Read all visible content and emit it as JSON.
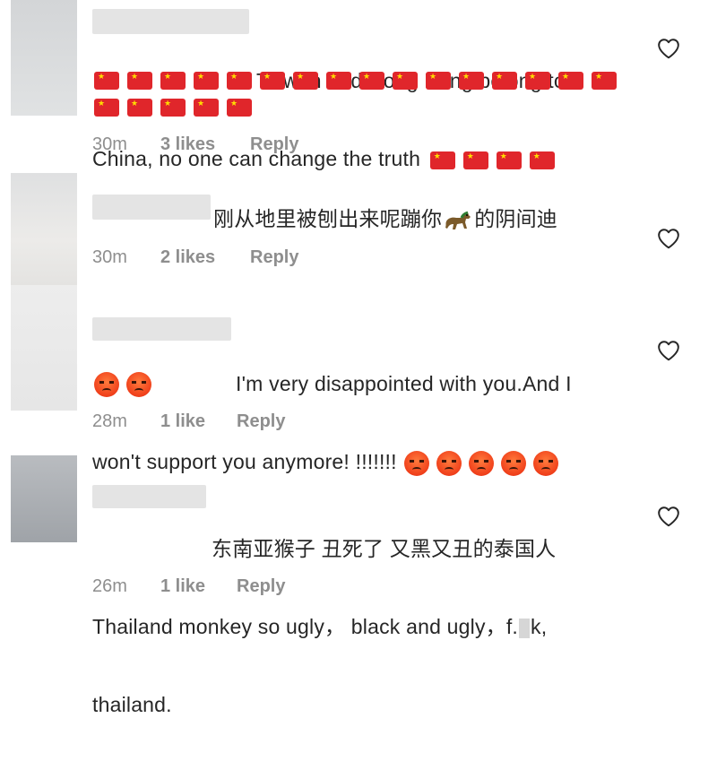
{
  "comments": [
    {
      "text_line1": "Taiwan and Hong Kong belong to",
      "text_line2": "China, no one can change the truth",
      "flag_emoji_count": 21,
      "time": "30m",
      "likes": "3 likes",
      "reply": "Reply"
    },
    {
      "text": "刚从地里被刨出来呢蹦你🐎的阴间迪",
      "text_before": "刚从地里被刨出来呢蹦你",
      "text_after": "的阴间迪",
      "emoji": "horse-emoji",
      "time": "30m",
      "likes": "2 likes",
      "reply": "Reply"
    },
    {
      "text_line1": "I'm very disappointed with you.And I",
      "text_line2": "won't support you anymore! !!!!!!!",
      "angry_emoji_count": 7,
      "time": "28m",
      "likes": "1 like",
      "reply": "Reply"
    },
    {
      "text_line1": "东南亚猴子 丑死了 又黑又丑的泰国人",
      "text_line2": "Thailand monkey so ugly， black and ugly，f.",
      "text_line2_end": "k,",
      "text_line3": "thailand.",
      "time": "26m",
      "likes": "1 like",
      "reply": "Reply"
    }
  ],
  "icons": {
    "like": "heart-outline-icon"
  },
  "colors": {
    "text": "#262626",
    "meta": "#8e8e8e",
    "flag": "#e0262b",
    "angry": "#f0401b"
  }
}
